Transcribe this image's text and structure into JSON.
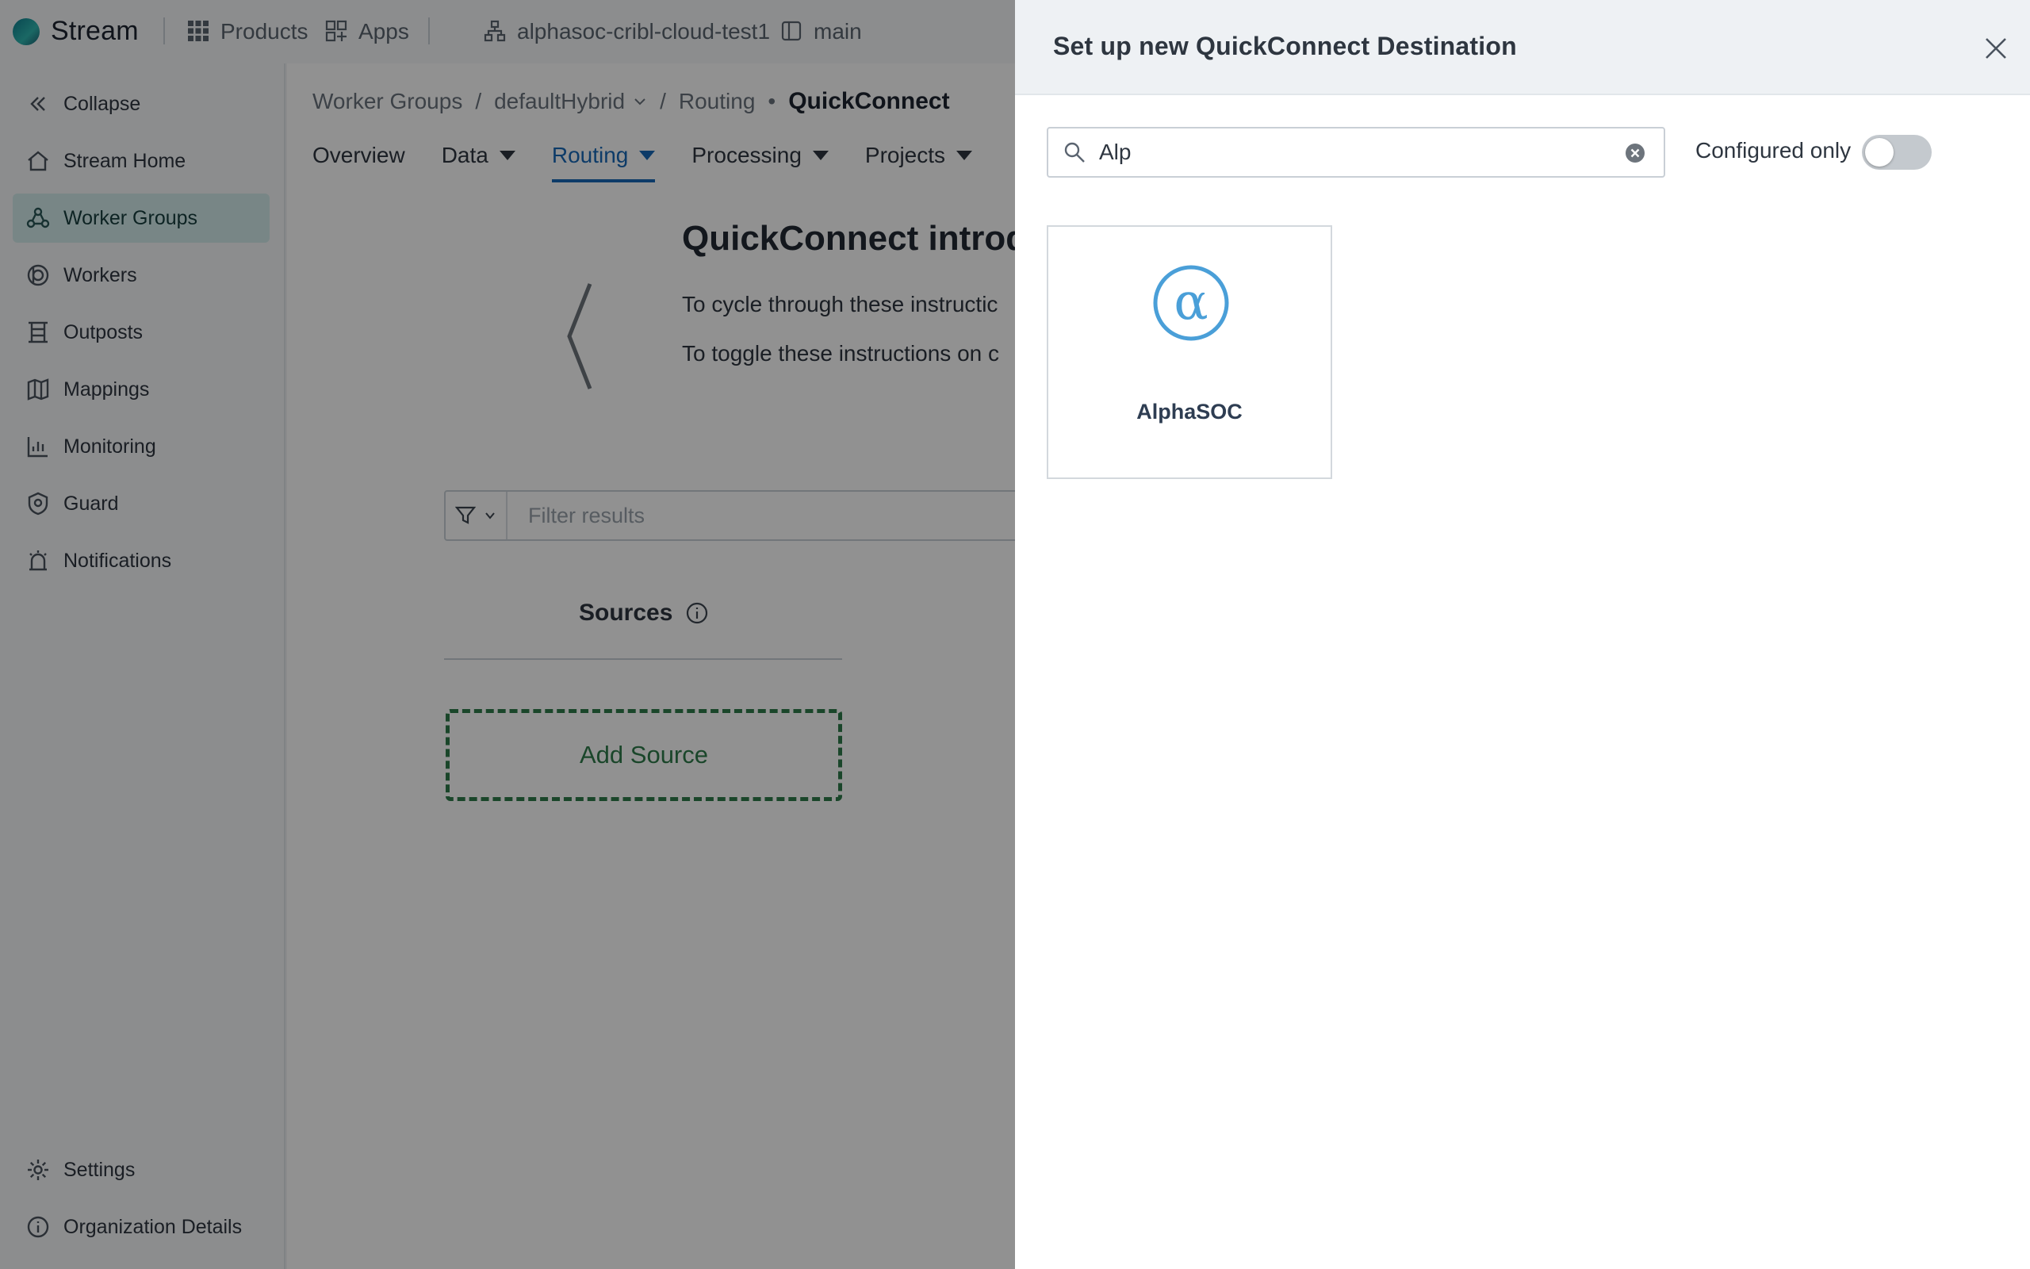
{
  "topbar": {
    "brand": "Stream",
    "products_label": "Products",
    "apps_label": "Apps",
    "workspace": "alphasoc-cribl-cloud-test1",
    "branch": "main"
  },
  "sidebar": {
    "items": [
      {
        "label": "Collapse",
        "icon": "double-chevron-left-icon"
      },
      {
        "label": "Stream Home",
        "icon": "home-icon"
      },
      {
        "label": "Worker Groups",
        "icon": "worker-groups-icon",
        "active": true
      },
      {
        "label": "Workers",
        "icon": "workers-icon"
      },
      {
        "label": "Outposts",
        "icon": "outposts-icon"
      },
      {
        "label": "Mappings",
        "icon": "map-icon"
      },
      {
        "label": "Monitoring",
        "icon": "chart-icon"
      },
      {
        "label": "Guard",
        "icon": "shield-icon"
      },
      {
        "label": "Notifications",
        "icon": "alarm-icon"
      }
    ],
    "bottom": [
      {
        "label": "Settings",
        "icon": "gear-icon"
      },
      {
        "label": "Organization Details",
        "icon": "info-icon"
      }
    ]
  },
  "main": {
    "breadcrumb": [
      "Worker Groups",
      "defaultHybrid",
      "Routing",
      "QuickConnect"
    ],
    "tabs": [
      {
        "label": "Overview"
      },
      {
        "label": "Data"
      },
      {
        "label": "Routing",
        "active": true
      },
      {
        "label": "Processing"
      },
      {
        "label": "Projects"
      }
    ],
    "intro_title": "QuickConnect introd",
    "intro_line_1": "To cycle through these instructic",
    "intro_line_2": "To toggle these instructions on c",
    "filter_placeholder": "Filter results",
    "sources_label": "Sources",
    "add_source_label": "Add Source"
  },
  "drawer": {
    "title": "Set up new QuickConnect Destination",
    "search_value": "Alp",
    "configured_only_label": "Configured only",
    "configured_only_on": false,
    "results": [
      {
        "name": "AlphaSOC",
        "logo_glyph": "α"
      }
    ]
  },
  "colors": {
    "accent": "#1869b8",
    "active_nav_bg": "#d3ecec",
    "add_source": "#2f7b4b",
    "alphasoc_blue": "#4a9fd8"
  }
}
